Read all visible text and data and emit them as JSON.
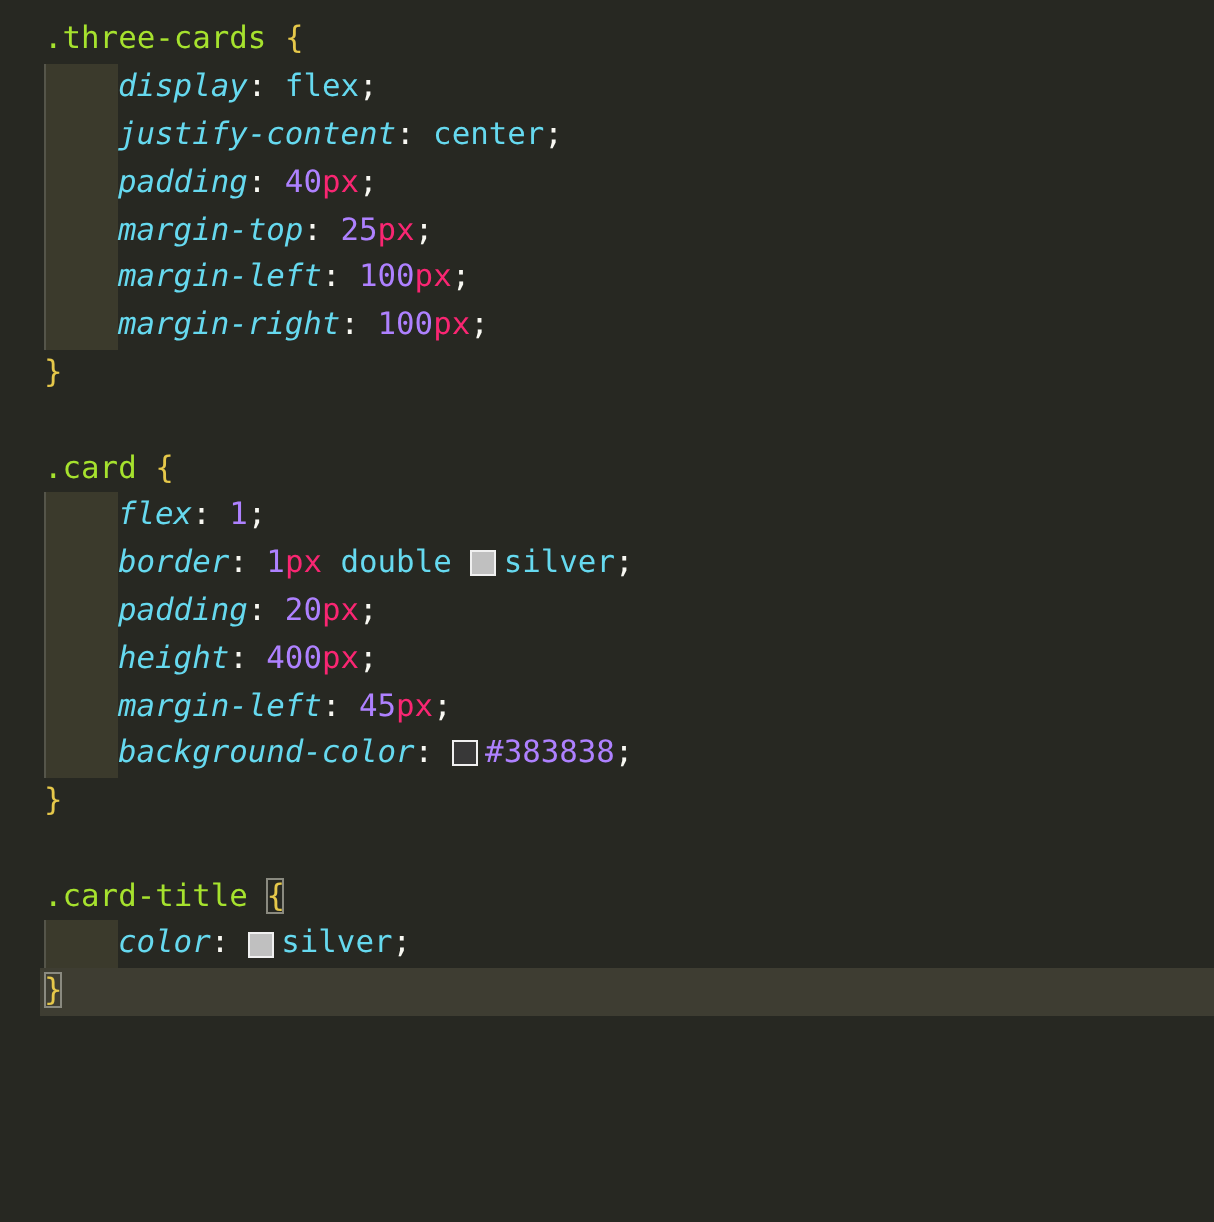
{
  "lines": [
    {
      "indented": false,
      "current": false,
      "tokens": [
        {
          "text": ".three-cards",
          "kind": "selector"
        },
        {
          "text": "{",
          "kind": "brace",
          "matched": false
        }
      ]
    },
    {
      "indented": true,
      "current": false,
      "tokens": [
        {
          "text": "display",
          "kind": "property"
        },
        {
          "text": ":",
          "kind": "punct"
        },
        {
          "text": "flex",
          "kind": "value"
        },
        {
          "text": ";",
          "kind": "punct"
        }
      ]
    },
    {
      "indented": true,
      "current": false,
      "tokens": [
        {
          "text": "justify-content",
          "kind": "property"
        },
        {
          "text": ":",
          "kind": "punct"
        },
        {
          "text": "center",
          "kind": "value"
        },
        {
          "text": ";",
          "kind": "punct"
        }
      ]
    },
    {
      "indented": true,
      "current": false,
      "tokens": [
        {
          "text": "padding",
          "kind": "property"
        },
        {
          "text": ":",
          "kind": "punct"
        },
        {
          "text": "40",
          "kind": "number"
        },
        {
          "text": "px",
          "kind": "unit"
        },
        {
          "text": ";",
          "kind": "punct"
        }
      ]
    },
    {
      "indented": true,
      "current": false,
      "tokens": [
        {
          "text": "margin-top",
          "kind": "property"
        },
        {
          "text": ":",
          "kind": "punct"
        },
        {
          "text": "25",
          "kind": "number"
        },
        {
          "text": "px",
          "kind": "unit"
        },
        {
          "text": ";",
          "kind": "punct"
        }
      ]
    },
    {
      "indented": true,
      "current": false,
      "tokens": [
        {
          "text": "margin-left",
          "kind": "property"
        },
        {
          "text": ":",
          "kind": "punct"
        },
        {
          "text": "100",
          "kind": "number"
        },
        {
          "text": "px",
          "kind": "unit"
        },
        {
          "text": ";",
          "kind": "punct"
        }
      ]
    },
    {
      "indented": true,
      "current": false,
      "tokens": [
        {
          "text": "margin-right",
          "kind": "property"
        },
        {
          "text": ":",
          "kind": "punct"
        },
        {
          "text": "100",
          "kind": "number"
        },
        {
          "text": "px",
          "kind": "unit"
        },
        {
          "text": ";",
          "kind": "punct"
        }
      ]
    },
    {
      "indented": false,
      "current": false,
      "tokens": [
        {
          "text": "}",
          "kind": "brace",
          "matched": false
        }
      ]
    },
    {
      "indented": false,
      "current": false
    },
    {
      "indented": false,
      "current": false,
      "tokens": [
        {
          "text": ".card",
          "kind": "selector"
        },
        {
          "text": "{",
          "kind": "brace",
          "matched": false
        }
      ]
    },
    {
      "indented": true,
      "current": false,
      "tokens": [
        {
          "text": "flex",
          "kind": "property"
        },
        {
          "text": ":",
          "kind": "punct"
        },
        {
          "text": "1",
          "kind": "number"
        },
        {
          "text": ";",
          "kind": "punct"
        }
      ]
    },
    {
      "indented": true,
      "current": false,
      "tokens": [
        {
          "text": "border",
          "kind": "property"
        },
        {
          "text": ":",
          "kind": "punct"
        },
        {
          "text": "1",
          "kind": "number"
        },
        {
          "text": "px",
          "kind": "unit"
        },
        {
          "text": "double",
          "kind": "value"
        },
        {
          "kind": "swatch",
          "color": "#c0c0c0"
        },
        {
          "text": "silver",
          "kind": "value"
        },
        {
          "text": ";",
          "kind": "punct"
        }
      ]
    },
    {
      "indented": true,
      "current": false,
      "tokens": [
        {
          "text": "padding",
          "kind": "property"
        },
        {
          "text": ":",
          "kind": "punct"
        },
        {
          "text": "20",
          "kind": "number"
        },
        {
          "text": "px",
          "kind": "unit"
        },
        {
          "text": ";",
          "kind": "punct"
        }
      ]
    },
    {
      "indented": true,
      "current": false,
      "tokens": [
        {
          "text": "height",
          "kind": "property"
        },
        {
          "text": ":",
          "kind": "punct"
        },
        {
          "text": "400",
          "kind": "number"
        },
        {
          "text": "px",
          "kind": "unit"
        },
        {
          "text": ";",
          "kind": "punct"
        }
      ]
    },
    {
      "indented": true,
      "current": false,
      "tokens": [
        {
          "text": "margin-left",
          "kind": "property"
        },
        {
          "text": ":",
          "kind": "punct"
        },
        {
          "text": "45",
          "kind": "number"
        },
        {
          "text": "px",
          "kind": "unit"
        },
        {
          "text": ";",
          "kind": "punct"
        }
      ]
    },
    {
      "indented": true,
      "current": false,
      "tokens": [
        {
          "text": "background-color",
          "kind": "property"
        },
        {
          "text": ":",
          "kind": "punct"
        },
        {
          "kind": "swatch",
          "color": "#383838"
        },
        {
          "text": "#383838",
          "kind": "number"
        },
        {
          "text": ";",
          "kind": "punct"
        }
      ]
    },
    {
      "indented": false,
      "current": false,
      "tokens": [
        {
          "text": "}",
          "kind": "brace",
          "matched": false
        }
      ]
    },
    {
      "indented": false,
      "current": false
    },
    {
      "indented": false,
      "current": false,
      "tokens": [
        {
          "text": ".card-title",
          "kind": "selector"
        },
        {
          "text": "{",
          "kind": "brace",
          "matched": true
        }
      ]
    },
    {
      "indented": true,
      "current": false,
      "tokens": [
        {
          "text": "color",
          "kind": "property"
        },
        {
          "text": ":",
          "kind": "punct"
        },
        {
          "kind": "swatch",
          "color": "#c0c0c0"
        },
        {
          "text": "silver",
          "kind": "value"
        },
        {
          "text": ";",
          "kind": "punct"
        }
      ]
    },
    {
      "indented": false,
      "current": true,
      "tokens": [
        {
          "text": "}",
          "kind": "brace",
          "matched": true
        }
      ]
    }
  ]
}
